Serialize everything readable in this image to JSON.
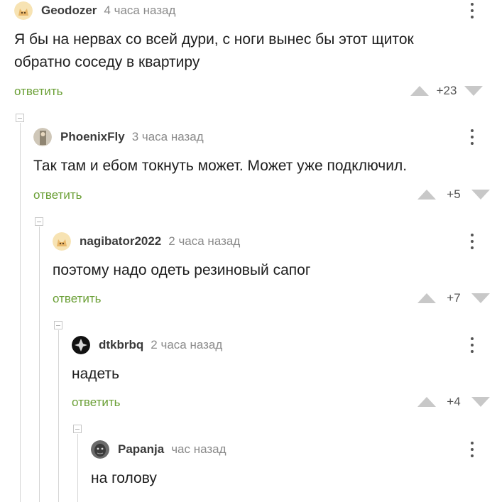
{
  "comments": [
    {
      "username": "Geodozer",
      "time": "4 часа назад",
      "text": "Я бы на нервах со всей дури, с ноги вынес бы этот щиток\nобратно соседу в квартиру",
      "reply_label": "ответить",
      "score": "+23",
      "avatar_icon": "avatar-cat-icon"
    },
    {
      "username": "PhoenixFly",
      "time": "3 часа назад",
      "text": "Так там и ебом токнуть может. Может уже подключил.",
      "reply_label": "ответить",
      "score": "+5",
      "avatar_icon": "avatar-person-icon"
    },
    {
      "username": "nagibator2022",
      "time": "2 часа назад",
      "text": "поэтому надо одеть резиновый сапог",
      "reply_label": "ответить",
      "score": "+7",
      "avatar_icon": "avatar-cat-icon"
    },
    {
      "username": "dtkbrbq",
      "time": "2 часа назад",
      "text": "надеть",
      "reply_label": "ответить",
      "score": "+4",
      "avatar_icon": "avatar-dark-icon"
    },
    {
      "username": "Papanja",
      "time": "час назад",
      "text": "на голову",
      "avatar_icon": "avatar-face-icon"
    }
  ],
  "colors": {
    "reply": "#6a9f35",
    "vote_arrow": "#c8c8c8",
    "thread_line": "#d6d6d6",
    "username": "#3a3a3a",
    "time": "#8a8a8a"
  }
}
